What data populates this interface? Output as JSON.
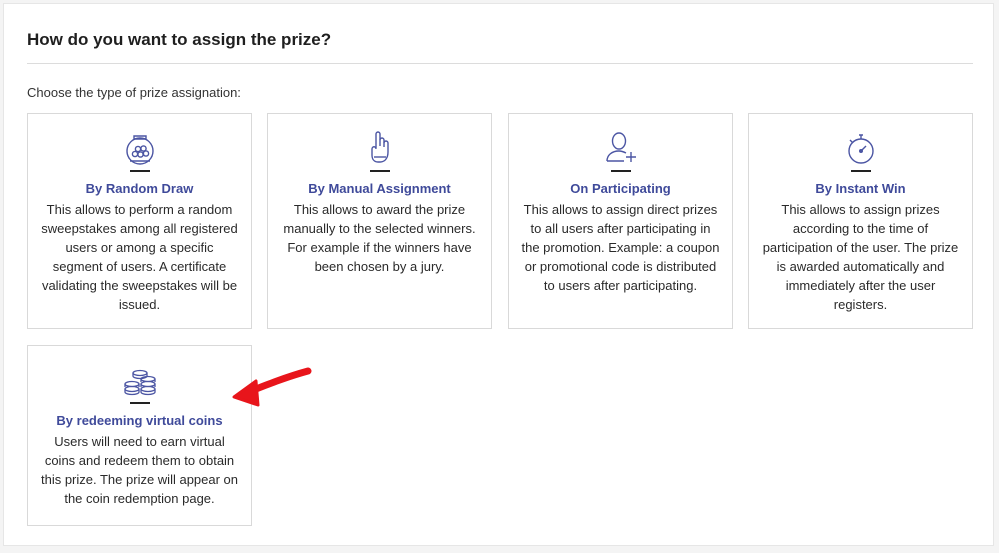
{
  "header": {
    "title": "How do you want to assign the prize?",
    "subtitle": "Choose the type of prize assignation:"
  },
  "colors": {
    "accent": "#3f4a9a",
    "icon": "#4b55a3",
    "arrow": "#e8151b"
  },
  "options": [
    {
      "icon": "gumball-machine-icon",
      "title": "By Random Draw",
      "description": "This allows to perform a random sweepstakes among all registered users or among a specific segment of users. A certificate validating the sweepstakes will be issued."
    },
    {
      "icon": "raised-hand-icon",
      "title": "By Manual Assignment",
      "description": "This allows to award the prize manually to the selected winners. For example if the winners have been chosen by a jury."
    },
    {
      "icon": "user-plus-icon",
      "title": "On Participating",
      "description": "This allows to assign direct prizes to all users after participating in the promotion. Example: a coupon or promotional code is distributed to users after participating."
    },
    {
      "icon": "stopwatch-icon",
      "title": "By Instant Win",
      "description": "This allows to assign prizes according to the time of participation of the user. The prize is awarded automatically and immediately after the user registers."
    },
    {
      "icon": "coins-stack-icon",
      "title": "By redeeming virtual coins",
      "description": "Users will need to earn virtual coins and redeem them to obtain this prize. The prize will appear on the coin redemption page."
    }
  ]
}
